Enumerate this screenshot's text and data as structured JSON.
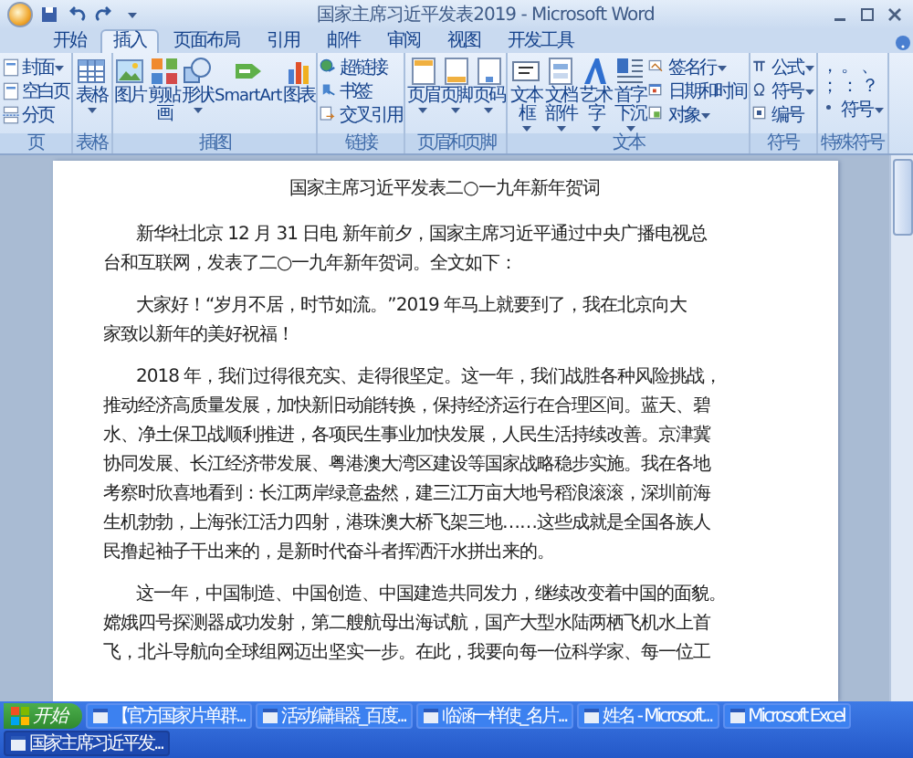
{
  "window": {
    "title": "国家主席习近平发表2019 - Microsoft Word"
  },
  "tabs": [
    {
      "label": "开始",
      "selected": false
    },
    {
      "label": "插入",
      "selected": true
    },
    {
      "label": "页面布局",
      "selected": false
    },
    {
      "label": "引用",
      "selected": false
    },
    {
      "label": "邮件",
      "selected": false
    },
    {
      "label": "审阅",
      "selected": false
    },
    {
      "label": "视图",
      "selected": false
    },
    {
      "label": "开发工具",
      "selected": false
    }
  ],
  "ribbon": {
    "groups": [
      {
        "label": "页",
        "items": [
          {
            "kind": "stack",
            "buttons": [
              {
                "label": "封面",
                "dropdown": true
              },
              {
                "label": "空白页",
                "dropdown": false
              },
              {
                "label": "分页",
                "dropdown": false
              }
            ]
          }
        ]
      },
      {
        "label": "表格",
        "items": [
          {
            "kind": "large",
            "label": "表格",
            "dropdown": true
          }
        ]
      },
      {
        "label": "插图",
        "items": [
          {
            "kind": "large",
            "label": "图片",
            "dropdown": false
          },
          {
            "kind": "large",
            "label": "剪贴画",
            "dropdown": false
          },
          {
            "kind": "large",
            "label": "形状",
            "dropdown": true
          },
          {
            "kind": "large",
            "label": "SmartArt",
            "dropdown": false
          },
          {
            "kind": "large",
            "label": "图表",
            "dropdown": false
          }
        ]
      },
      {
        "label": "链接",
        "items": [
          {
            "kind": "stack",
            "buttons": [
              {
                "label": "超链接",
                "dropdown": false
              },
              {
                "label": "书签",
                "dropdown": false
              },
              {
                "label": "交叉引用",
                "dropdown": false
              }
            ]
          }
        ]
      },
      {
        "label": "页眉和页脚",
        "items": [
          {
            "kind": "large",
            "label": "页眉",
            "dropdown": true
          },
          {
            "kind": "large",
            "label": "页脚",
            "dropdown": true
          },
          {
            "kind": "large",
            "label": "页码",
            "dropdown": true
          }
        ]
      },
      {
        "label": "文本",
        "items": [
          {
            "kind": "large",
            "label": "文本框",
            "dropdown": true
          },
          {
            "kind": "large",
            "label": "文档部件",
            "dropdown": true
          },
          {
            "kind": "large",
            "label": "艺术字",
            "dropdown": true
          },
          {
            "kind": "large",
            "label": "首字下沉",
            "dropdown": true
          },
          {
            "kind": "stack",
            "buttons": [
              {
                "label": "签名行",
                "dropdown": true
              },
              {
                "label": "日期和时间",
                "dropdown": false
              },
              {
                "label": "对象",
                "dropdown": true
              }
            ]
          }
        ]
      },
      {
        "label": "符号",
        "items": [
          {
            "kind": "stack",
            "buttons": [
              {
                "label": "公式",
                "dropdown": true
              },
              {
                "label": "符号",
                "dropdown": true
              },
              {
                "label": "编号",
                "dropdown": false
              }
            ]
          }
        ]
      },
      {
        "label": "特殊符号",
        "items": [
          {
            "kind": "marks",
            "marks": [
              "，",
              "。",
              "、",
              "；",
              "：",
              "？"
            ],
            "button": {
              "label": "符号",
              "dropdown": true
            }
          }
        ]
      }
    ]
  },
  "document": {
    "title": "国家主席习近平发表二○一九年新年贺词",
    "paragraphs": [
      {
        "lines": [
          "新华社北京 12 月 31 日电 新年前夕，国家主席习近平通过中央广播电视总",
          "台和互联网，发表了二○一九年新年贺词。全文如下："
        ]
      },
      {
        "lines": [
          "大家好！“岁月不居，时节如流。”2019 年马上就要到了，我在北京向大",
          "家致以新年的美好祝福！"
        ]
      },
      {
        "lines": [
          "2018 年，我们过得很充实、走得很坚定。这一年，我们战胜各种风险挑战，",
          "推动经济高质量发展，加快新旧动能转换，保持经济运行在合理区间。蓝天、碧",
          "水、净土保卫战顺利推进，各项民生事业加快发展，人民生活持续改善。京津冀",
          "协同发展、长江经济带发展、粤港澳大湾区建设等国家战略稳步实施。我在各地",
          "考察时欣喜地看到：长江两岸绿意盎然，建三江万亩大地号稻浪滚滚，深圳前海",
          "生机勃勃，上海张江活力四射，港珠澳大桥飞架三地……这些成就是全国各族人",
          "民撸起袖子干出来的，是新时代奋斗者挥洒汗水拼出来的。"
        ]
      },
      {
        "lines": [
          "这一年，中国制造、中国创造、中国建造共同发力，继续改变着中国的面貌。",
          "嫦娥四号探测器成功发射，第二艘航母出海试航，国产大型水陆两栖飞机水上首",
          "飞，北斗导航向全球组网迈出坚实一步。在此，我要向每一位科学家、每一位工"
        ]
      }
    ]
  },
  "taskbar": {
    "start": "开始",
    "items": [
      {
        "label": "【官方国家片单群...",
        "selected": false
      },
      {
        "label": "活动编辑器_百度...",
        "selected": false
      },
      {
        "label": "临涵一样使_名片...",
        "selected": false
      },
      {
        "label": "姓名 - Microsoft...",
        "selected": false
      },
      {
        "label": "Microsoft Excel",
        "selected": false
      },
      {
        "label": "国家主席习近平发...",
        "selected": true
      }
    ]
  }
}
